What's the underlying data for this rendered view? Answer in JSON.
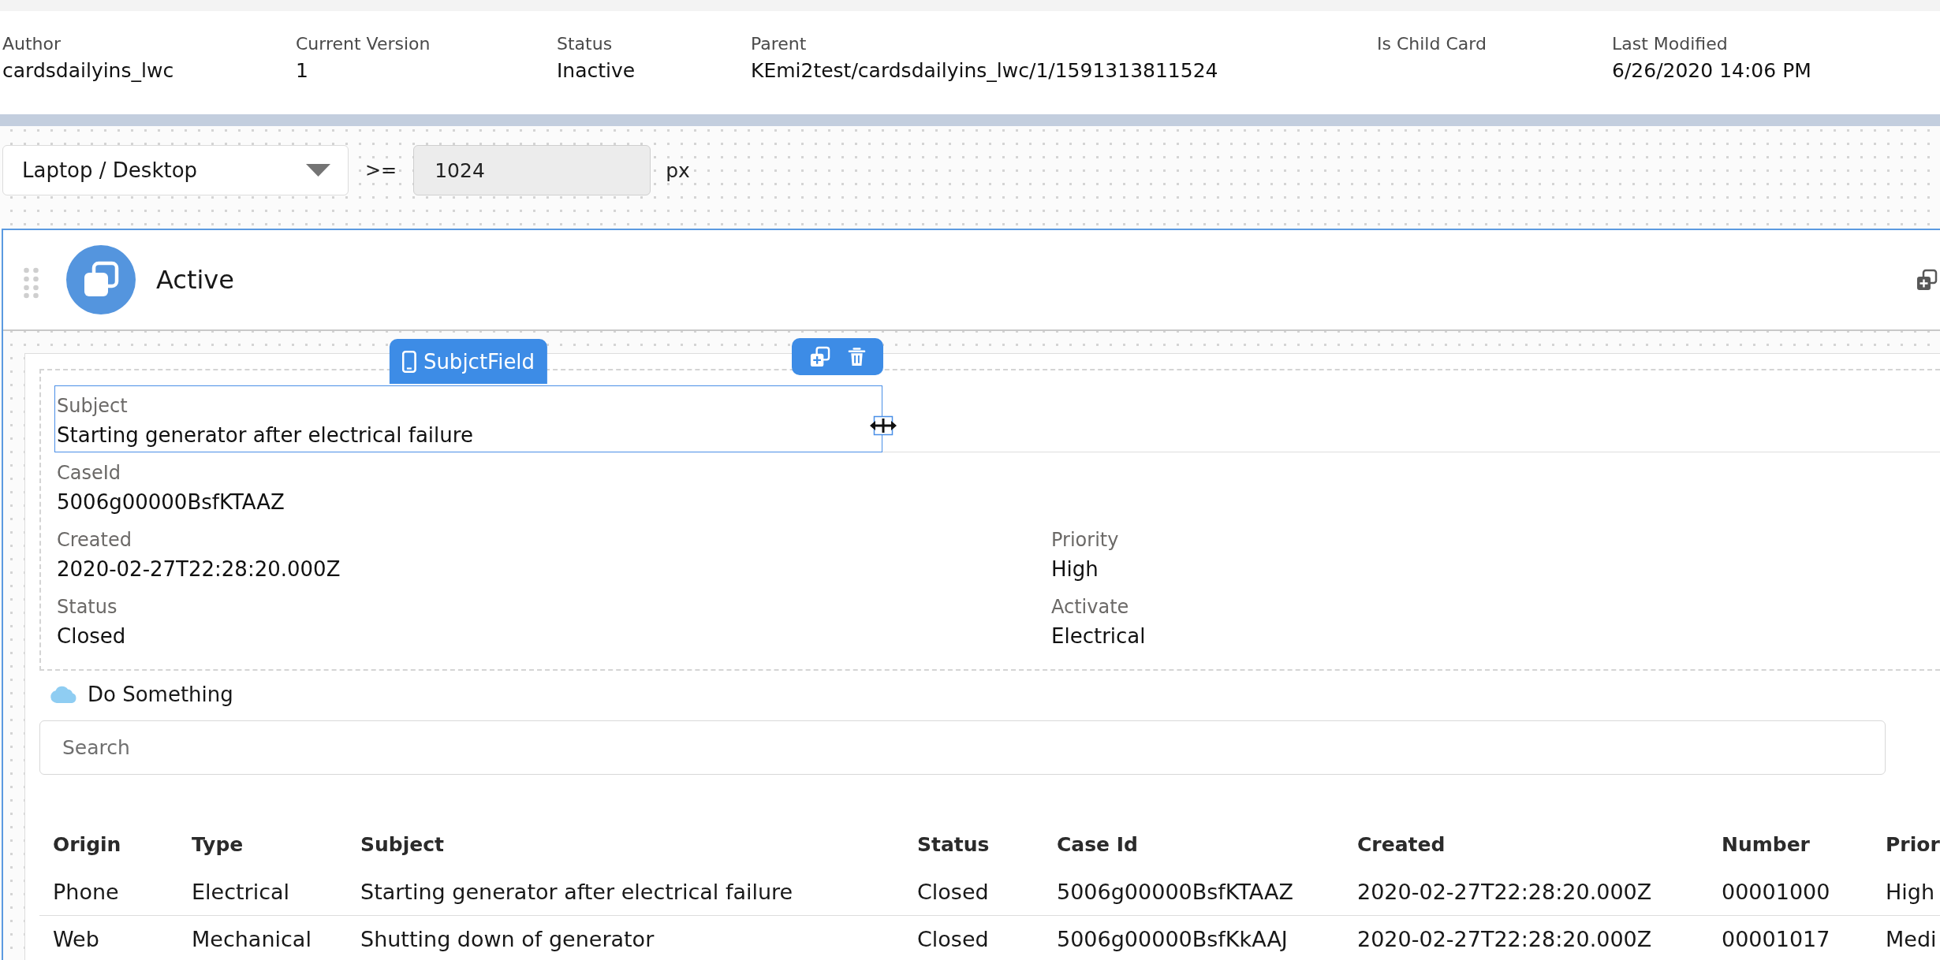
{
  "record_header": {
    "fields": [
      {
        "label": "Author",
        "value": "cardsdailyins_lwc"
      },
      {
        "label": "Current Version",
        "value": "1"
      },
      {
        "label": "Status",
        "value": "Inactive"
      },
      {
        "label": "Parent",
        "value": "KEmi2test/cardsdailyins_lwc/1/1591313811524"
      },
      {
        "label": "Is Child Card"
      },
      {
        "label": "Last Modified",
        "value": "6/26/2020 14:06 PM"
      }
    ]
  },
  "viewport": {
    "device": "Laptop / Desktop",
    "operator": ">=",
    "min_width": {
      "value": "1024",
      "disabled": true
    },
    "unit": "px"
  },
  "card": {
    "selected": true,
    "title": "Active",
    "block": {
      "element_label": "SubjctField",
      "rows": [
        {
          "fields": [
            {
              "label": "Subject",
              "value": "Starting generator after electrical failure",
              "selected": true
            }
          ]
        },
        {
          "fields": [
            {
              "label": "CaseId",
              "value": "5006g00000BsfKTAAZ",
              "selected": false
            }
          ]
        },
        {
          "fields": [
            {
              "label": "Created",
              "value": "2020-02-27T22:28:20.000Z",
              "selected": false
            },
            {
              "label": "Priority",
              "value": "High",
              "selected": false
            }
          ]
        },
        {
          "fields": [
            {
              "label": "Status",
              "value": "Closed",
              "selected": false
            },
            {
              "label": "Activate",
              "value": "Electrical",
              "selected": false
            }
          ]
        }
      ]
    },
    "action": {
      "label": "Do Something"
    },
    "search": {
      "placeholder": "Search"
    },
    "table": {
      "columns": [
        "Origin",
        "Type",
        "Subject",
        "Status",
        "Case Id",
        "Created",
        "Number",
        "Prior"
      ],
      "rows": [
        [
          "Phone",
          "Electrical",
          "Starting generator after electrical failure",
          "Closed",
          "5006g00000BsfKTAAZ",
          "2020-02-27T22:28:20.000Z",
          "00001000",
          "High"
        ],
        [
          "Web",
          "Mechanical",
          "Shutting down of generator",
          "Closed",
          "5006g00000BsfKkAAJ",
          "2020-02-27T22:28:20.000Z",
          "00001017",
          "Medi"
        ]
      ]
    }
  }
}
